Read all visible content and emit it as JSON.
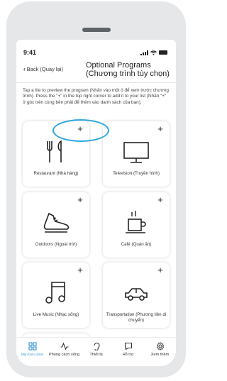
{
  "status_bar": {
    "time": "9:41"
  },
  "header": {
    "back_label": "Back (Quay lại)",
    "title": "Optional Programs (Chương trình tùy chọn)"
  },
  "description": "Tap a tile to preview the program (Nhấn vào một ô để xem trước chương trình). Press the \"+\" in the top right corner to add it to your list (Nhấn \"+\" ở góc trên cùng bên phải để thêm vào danh sách của bạn).",
  "tiles": [
    {
      "icon": "restaurant-icon",
      "label": "Restaurant (Nhà hàng)",
      "add": "+"
    },
    {
      "icon": "television-icon",
      "label": "Television (Truyền hình)",
      "add": "+"
    },
    {
      "icon": "shoe-icon",
      "label": "Outdoors (Ngoài trời)",
      "add": "+"
    },
    {
      "icon": "coffee-cup-icon",
      "label": "Café (Quán ăn)",
      "add": "+"
    },
    {
      "icon": "music-note-icon",
      "label": "Live Music (Nhạc sống)",
      "add": "+"
    },
    {
      "icon": "car-icon",
      "label": "Transportation (Phương tiện di chuyển)",
      "add": "+"
    },
    {
      "icon": "",
      "label": "",
      "add": "+"
    }
  ],
  "tabbar": {
    "items": [
      {
        "icon": "home-grid-icon",
        "label": "Màn hình chính",
        "active": true
      },
      {
        "icon": "lifestyle-icon",
        "label": "Phong cách sống",
        "active": false
      },
      {
        "icon": "ear-icon",
        "label": "Thiết bị",
        "active": false
      },
      {
        "icon": "chat-bubble-icon",
        "label": "Hỗ trợ",
        "active": false
      },
      {
        "icon": "gear-icon",
        "label": "Xem thêm",
        "active": false
      }
    ]
  },
  "colors": {
    "accent": "#2e8fd1",
    "highlight": "#2ea7e0",
    "device": "#e6e7e9"
  }
}
